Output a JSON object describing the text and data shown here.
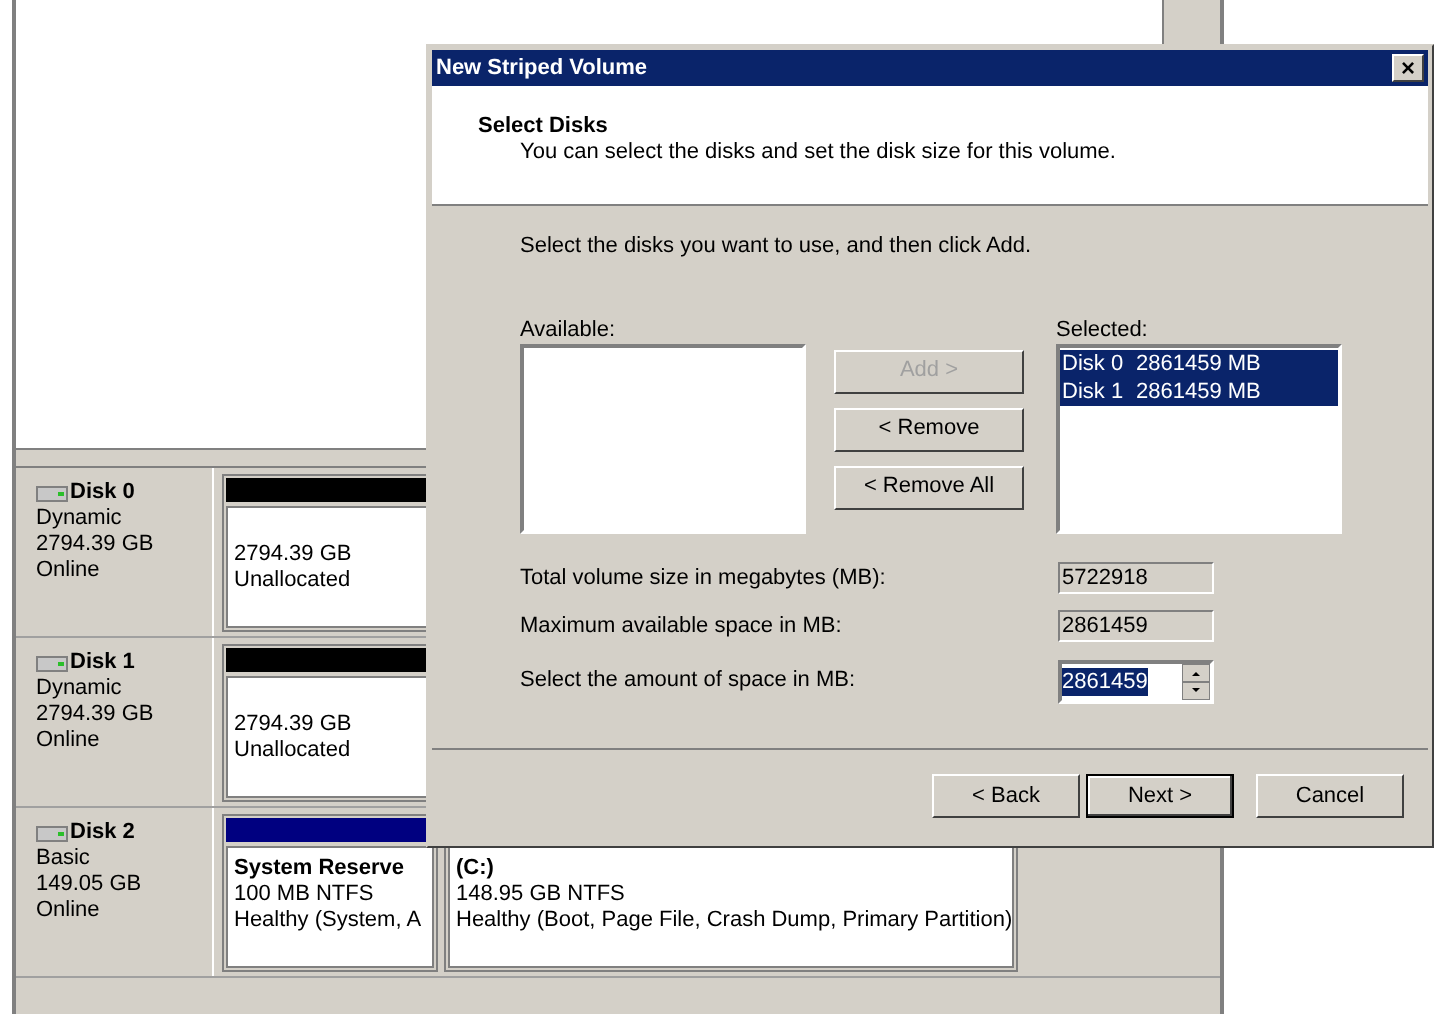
{
  "disks": [
    {
      "name": "Disk 0",
      "type": "Dynamic",
      "size": "2794.39 GB",
      "status": "Online",
      "partitions": [
        {
          "lines": [
            "2794.39 GB",
            "Unallocated"
          ],
          "color": "#000000"
        }
      ]
    },
    {
      "name": "Disk 1",
      "type": "Dynamic",
      "size": "2794.39 GB",
      "status": "Online",
      "partitions": [
        {
          "lines": [
            "2794.39 GB",
            "Unallocated"
          ],
          "color": "#000000"
        }
      ]
    },
    {
      "name": "Disk 2",
      "type": "Basic",
      "size": "149.05 GB",
      "status": "Online",
      "partitions": [
        {
          "title": "System Reserve",
          "lines": [
            "100 MB NTFS",
            "Healthy (System, A"
          ],
          "color": "#000080"
        },
        {
          "title": "(C:)",
          "lines": [
            "148.95 GB NTFS",
            "Healthy (Boot, Page File, Crash Dump, Primary Partition)"
          ]
        }
      ]
    }
  ],
  "dialog": {
    "title": "New Striped Volume",
    "close": "×",
    "heading": "Select Disks",
    "subheading": "You can select the disks and set the disk size for this volume.",
    "instruction": "Select the disks you want to use, and then click Add.",
    "available": {
      "label": "Available:"
    },
    "move_buttons": [
      {
        "label": "Add >",
        "disabled": true
      },
      {
        "label": "< Remove",
        "disabled": false
      },
      {
        "label": "< Remove All",
        "disabled": false
      }
    ],
    "selected": {
      "label": "Selected:",
      "items": [
        {
          "disk": "Disk 0",
          "size": "2861459 MB",
          "selected": true
        },
        {
          "disk": "Disk 1",
          "size": "2861459 MB",
          "selected": true
        }
      ]
    },
    "fields": [
      {
        "kind": "readonly",
        "label": "Total volume size in megabytes (MB):",
        "value": "5722918"
      },
      {
        "kind": "readonly",
        "label": "Maximum available space in MB:",
        "value": "2861459"
      },
      {
        "kind": "spin",
        "label": "Select the amount of space in MB:",
        "value": "2861459"
      }
    ],
    "buttons": [
      {
        "label": "< Back",
        "default": false
      },
      {
        "label": "Next >",
        "default": true
      },
      {
        "label": "Cancel",
        "default": false
      }
    ]
  }
}
